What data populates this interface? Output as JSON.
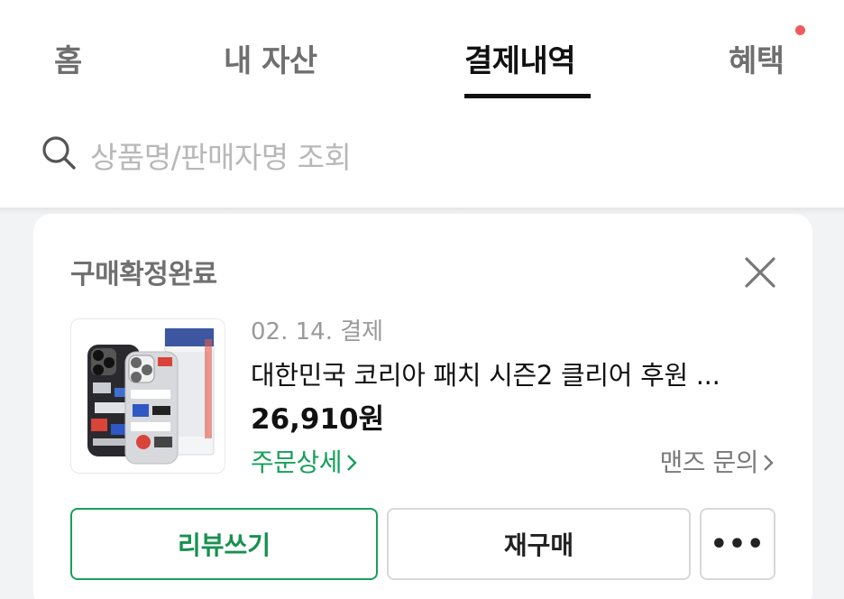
{
  "tabs": [
    {
      "label": "홈",
      "active": false
    },
    {
      "label": "내 자산",
      "active": false
    },
    {
      "label": "결제내역",
      "active": true
    },
    {
      "label": "혜택",
      "active": false,
      "has_notification_dot": true
    }
  ],
  "search": {
    "placeholder": "상품명/판매자명 조회",
    "icon": "search-icon"
  },
  "order": {
    "status": "구매확정완료",
    "date": "02. 14. 결제",
    "product_name": "대한민국 코리아 패치 시즌2 클리어 후원 ...",
    "price": "26,910원",
    "order_detail_link": "주문상세",
    "inquiry_link": "맨즈 문의",
    "buttons": {
      "review": "리뷰쓰기",
      "rebuy": "재구매",
      "more": "•••"
    }
  },
  "colors": {
    "accent_green": "#16a05a",
    "notification_red": "#f05a5a",
    "page_bg": "#f2f3f5"
  }
}
